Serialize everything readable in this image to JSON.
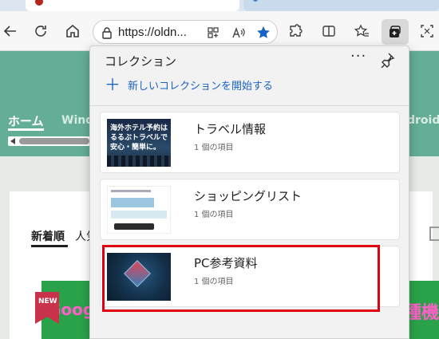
{
  "browser": {
    "address_bar": {
      "url": "https://oldn..."
    }
  },
  "website": {
    "nav": {
      "home": "ホーム",
      "windows": "Wind",
      "android": "droid"
    },
    "tabs": {
      "new": "新着順",
      "popular": "人気"
    },
    "banner": {
      "left_text": "Goog",
      "right_text": "種機"
    },
    "badge": "NEW"
  },
  "collections_panel": {
    "title": "コレクション",
    "more_label": "···",
    "start_new_label": "新しいコレクションを開始する",
    "items": [
      {
        "name": "トラベル情報",
        "count": "1 個の項目",
        "thumbnail_text": "海外ホテル予約はるるぶトラベルで安心・簡単に。"
      },
      {
        "name": "ショッピングリスト",
        "count": "1 個の項目"
      },
      {
        "name": "PC参考資料",
        "count": "1 個の項目"
      }
    ],
    "highlighted_item": "PC参考資料"
  },
  "colors": {
    "site_header": "#64ad96",
    "accent_blue": "#1a63c4",
    "highlight_red": "#e0000f",
    "favorite_star": "#1a63c4"
  }
}
